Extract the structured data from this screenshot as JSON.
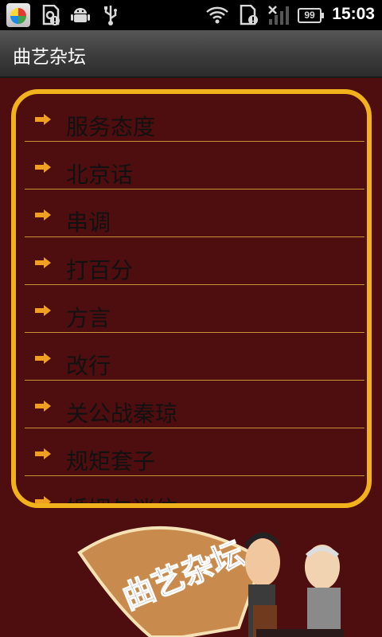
{
  "status_bar": {
    "time": "15:03",
    "battery": "99",
    "icons": [
      "app-store-icon",
      "sd-card-alert-icon",
      "android-debug-icon",
      "usb-icon",
      "wifi-icon",
      "sim-alert-icon",
      "no-signal-icon",
      "battery-icon"
    ]
  },
  "title_bar": {
    "title": "曲艺杂坛"
  },
  "menu": {
    "items": [
      {
        "label": "服务态度"
      },
      {
        "label": "北京话"
      },
      {
        "label": "串调"
      },
      {
        "label": "打百分"
      },
      {
        "label": "方言"
      },
      {
        "label": "改行"
      },
      {
        "label": "关公战秦琼"
      },
      {
        "label": "规矩套子"
      },
      {
        "label": "婚姻与迷信"
      }
    ]
  },
  "banner": {
    "logo_text": "曲艺杂坛"
  },
  "colors": {
    "background": "#4e0d0f",
    "frame": "#f2b21b",
    "divider": "#c9903a",
    "arrow": "#f0a020"
  }
}
